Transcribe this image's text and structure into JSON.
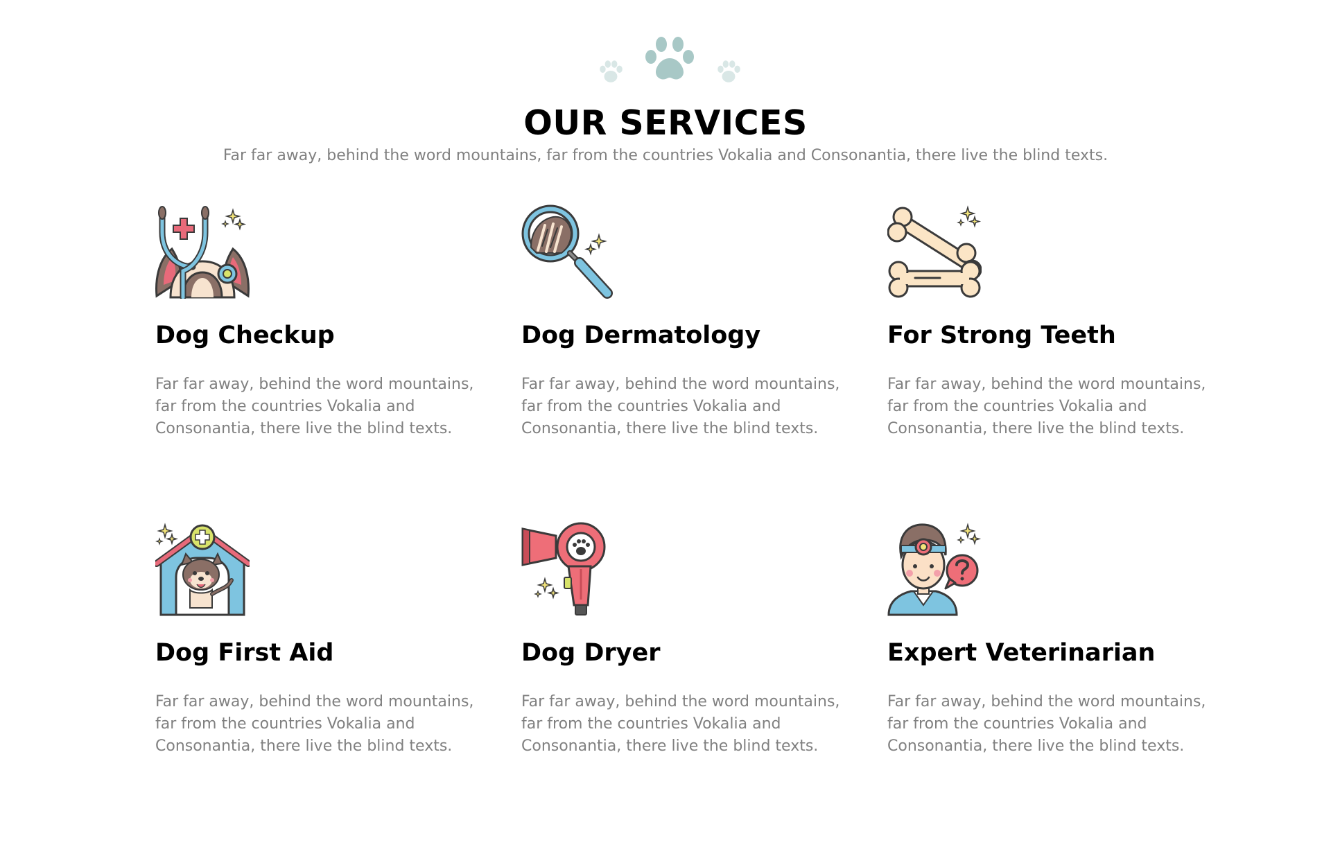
{
  "header": {
    "title": "OUR SERVICES",
    "subtitle": "Far far away, behind the word mountains, far from the countries Vokalia and Consonantia, there live the blind texts."
  },
  "decoration": {
    "icon": "paw-icon",
    "color_main": "#a8c8c6",
    "color_light": "#d9e7e6"
  },
  "services": [
    {
      "icon": "stethoscope-dog-icon",
      "title": "Dog Checkup",
      "description": "Far far away, behind the word mountains, far from the countries Vokalia and Consonantia, there live the blind texts."
    },
    {
      "icon": "magnifier-fur-icon",
      "title": "Dog Dermatology",
      "description": "Far far away, behind the word mountains, far from the countries Vokalia and Consonantia, there live the blind texts."
    },
    {
      "icon": "bones-icon",
      "title": "For Strong Teeth",
      "description": "Far far away, behind the word mountains, far from the countries Vokalia and Consonantia, there live the blind texts."
    },
    {
      "icon": "dog-house-first-aid-icon",
      "title": "Dog First Aid",
      "description": "Far far away, behind the word mountains, far from the countries Vokalia and Consonantia, there live the blind texts."
    },
    {
      "icon": "hair-dryer-icon",
      "title": "Dog Dryer",
      "description": "Far far away, behind the word mountains, far from the countries Vokalia and Consonantia, there live the blind texts."
    },
    {
      "icon": "veterinarian-icon",
      "title": "Expert Veterinarian",
      "description": "Far far away, behind the word mountains, far from the countries Vokalia and Consonantia, there live the blind texts."
    }
  ]
}
